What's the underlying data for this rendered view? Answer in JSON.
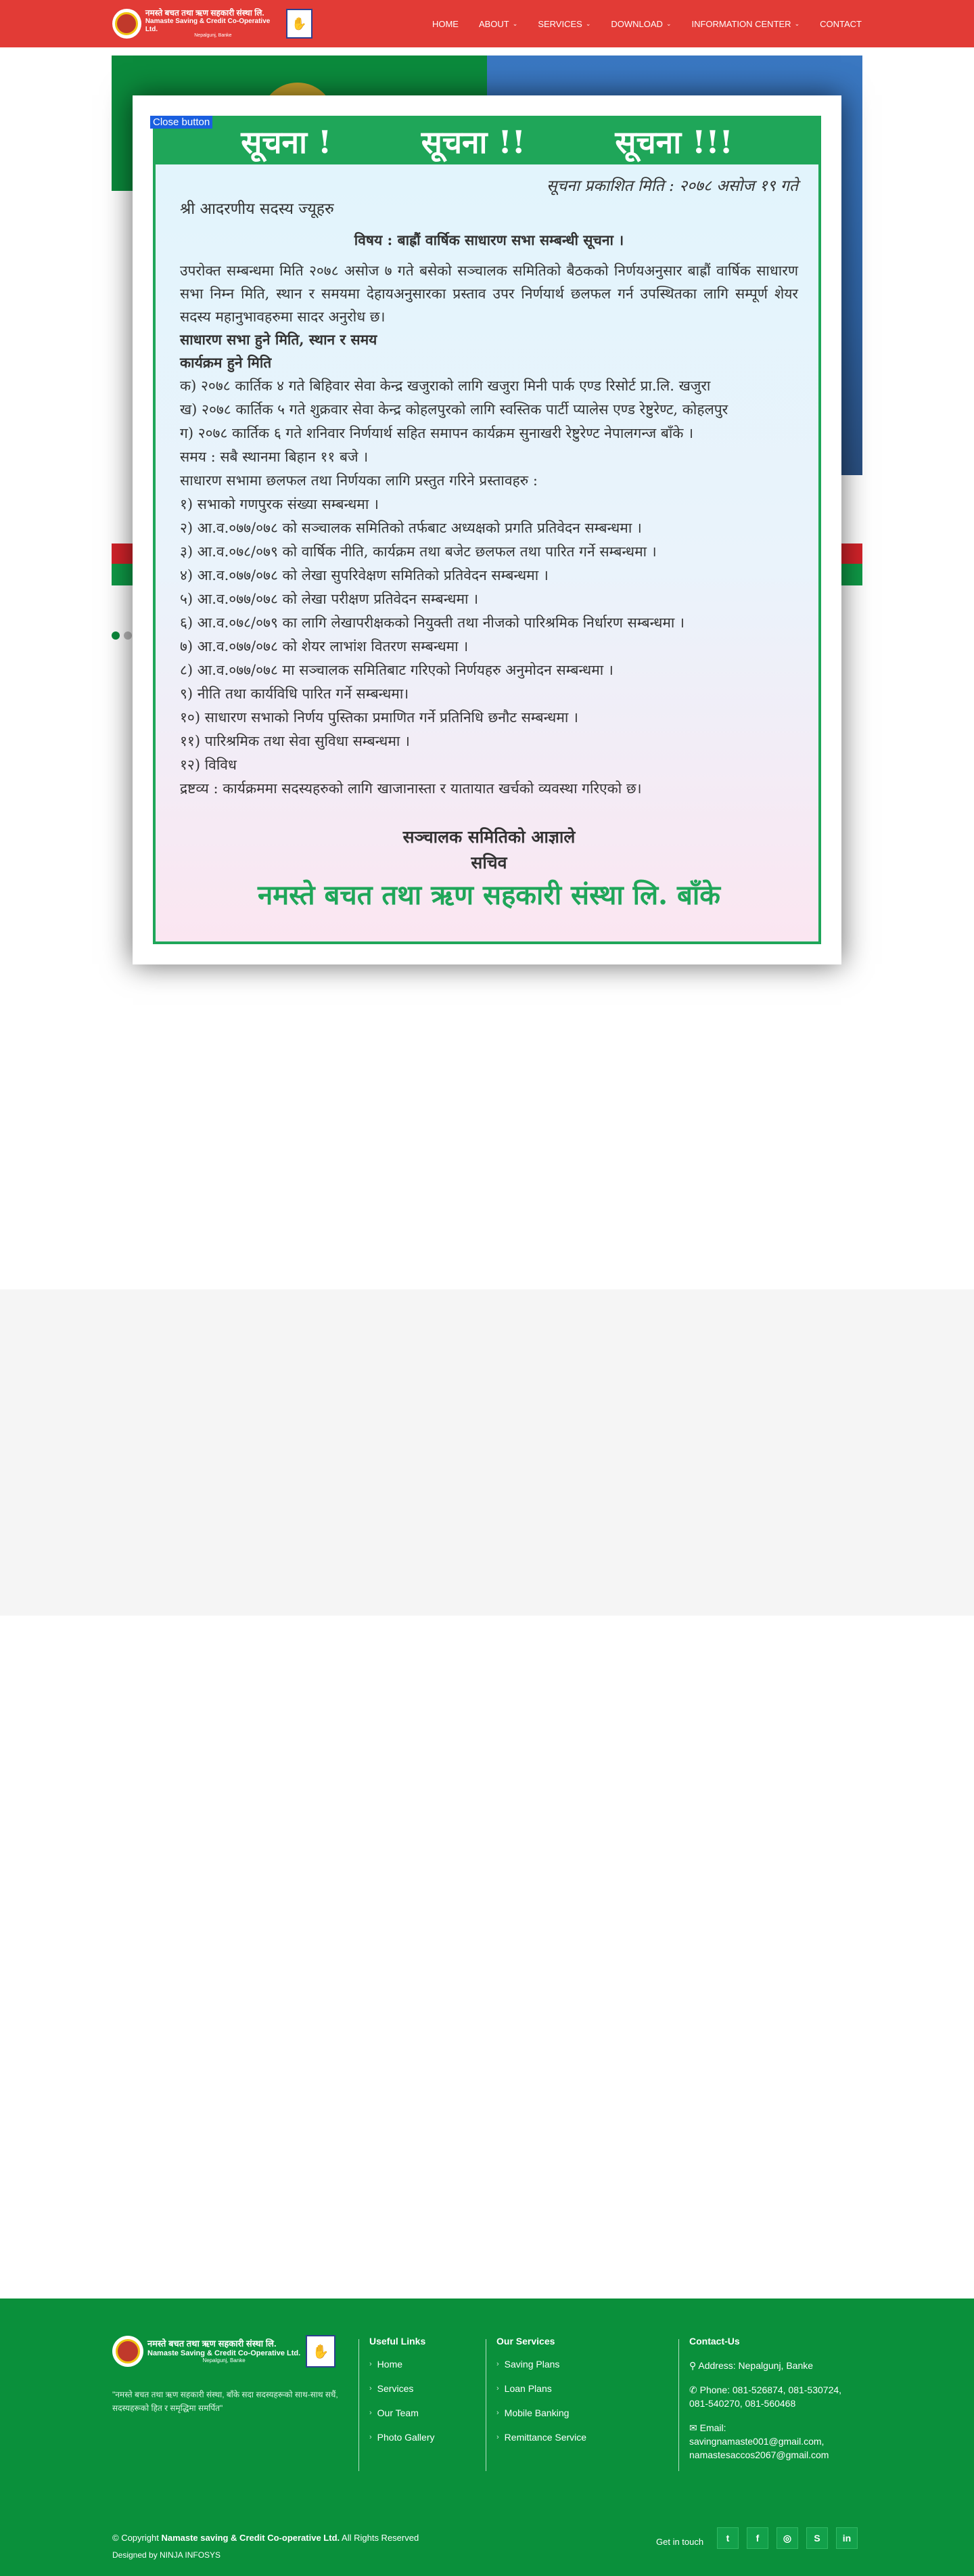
{
  "header": {
    "logo": {
      "line1": "नमस्ते बचत तथा ऋण सहकारी संस्था लि.",
      "line2": "Namaste Saving & Credit Co-Operative Ltd.",
      "line3": "Nepalgunj, Banke"
    },
    "nav": [
      {
        "label": "HOME",
        "dropdown": false
      },
      {
        "label": "ABOUT",
        "dropdown": true
      },
      {
        "label": "SERVICES",
        "dropdown": true
      },
      {
        "label": "DOWNLOAD",
        "dropdown": true
      },
      {
        "label": "INFORMATION CENTER",
        "dropdown": true
      },
      {
        "label": "CONTACT",
        "dropdown": false
      }
    ],
    "chevron": "⌄"
  },
  "modal": {
    "close_label": "Close button",
    "notice_heads": [
      "सूचना !",
      "सूचना !!",
      "सूचना !!!"
    ],
    "pub_date": "सूचना प्रकाशित मिति : २०७८ असोज १९ गते",
    "salutation": "श्री आदरणीय सदस्य ज्यूहरु",
    "subject": "विषय : बाह्रौं वार्षिक साधारण सभा सम्बन्धी सूचना ।",
    "intro": "उपरोक्त सम्बन्धमा मिति २०७८ असोज ७ गते बसेको सञ्चालक समितिको बैठकको निर्णयअनुसार बाह्रौं वार्षिक साधारण सभा निम्न मिति, स्थान र समयमा देहायअनुसारका प्रस्ताव उपर निर्णयार्थ छलफल गर्न उपस्थितका लागि सम्पूर्ण शेयर सदस्य महानुभावहरुमा सादर अनुरोध छ।",
    "h1": "साधारण सभा हुने मिति, स्थान र समय",
    "h2": "कार्यक्रम हुने मिति",
    "lines": [
      "क) २०७८ कार्तिक ४ गते बिहिवार सेवा केन्द्र खजुराको लागि खजुरा मिनी पार्क एण्ड रिसोर्ट प्रा.लि. खजुरा",
      "ख) २०७८ कार्तिक ५ गते शुक्रवार सेवा केन्द्र कोहलपुरको लागि स्वस्तिक पार्टी प्यालेस एण्ड रेष्टुरेण्ट, कोहलपुर",
      "ग) २०७८ कार्तिक ६ गते शनिवार निर्णयार्थ सहित समापन कार्यक्रम सुनाखरी रेष्टुरेण्ट नेपालगन्ज बाँके ।",
      "समय : सबै स्थानमा बिहान ११ बजे ।",
      "साधारण सभामा छलफल तथा निर्णयका लागि प्रस्तुत गरिने प्रस्तावहरु :",
      "१) सभाको गणपुरक संख्या सम्बन्धमा ।",
      "२) आ.व.०७७/०७८ को सञ्चालक समितिको तर्फबाट अध्यक्षको प्रगति प्रतिवेदन सम्बन्धमा ।",
      "३) आ.व.०७८/०७९ को वार्षिक नीति, कार्यक्रम तथा बजेट छलफल तथा पारित गर्ने सम्बन्धमा ।",
      "४) आ.व.०७७/०७८ को लेखा सुपरिवेक्षण समितिको प्रतिवेदन सम्बन्धमा ।",
      "५) आ.व.०७७/०७८ को लेखा परीक्षण प्रतिवेदन सम्बन्धमा ।",
      "६) आ.व.०७८/०७९ का लागि लेखापरीक्षकको नियुक्ती तथा नीजको पारिश्रमिक निर्धारण सम्बन्धमा ।",
      "७) आ.व.०७७/०७८ को शेयर लाभांश वितरण सम्बन्धमा ।",
      "८) आ.व.०७७/०७८ मा सञ्चालक समितिबाट गरिएको निर्णयहरु अनुमोदन सम्बन्धमा ।",
      "९) नीति तथा कार्यविधि पारित गर्ने सम्बन्धमा।",
      "१०) साधारण सभाको निर्णय पुस्तिका प्रमाणित गर्ने प्रतिनिधि छनौट सम्बन्धमा ।",
      "११) पारिश्रमिक तथा सेवा सुविधा सम्बन्धमा ।",
      "१२) विविध",
      "द्रष्टव्य : कार्यक्रममा सदस्यहरुको लागि खाजानास्ता र यातायात खर्चको व्यवस्था गरिएको छ।"
    ],
    "sign1": "सञ्चालक समितिको आज्ञाले",
    "sign2": "सचिव",
    "sign3": "नमस्ते बचत तथा ऋण सहकारी संस्था लि. बाँके"
  },
  "footer": {
    "logo": {
      "line1": "नमस्ते बचत तथा ऋण सहकारी संस्था लि.",
      "line2": "Namaste Saving & Credit Co-Operative Ltd.",
      "line3": "Nepalgunj, Banke"
    },
    "quote": "\"नमस्ते बचत तथा ऋण सहकारी संस्था, बाँके सदा सदस्यहरूको साथ-साथ सधैं, सदस्यहरूको हित र समृद्धिमा समर्पित\"",
    "useful_links_title": "Useful Links",
    "useful_links": [
      "Home",
      "Services",
      "Our Team",
      "Photo Gallery"
    ],
    "services_title": "Our Services",
    "services": [
      "Saving Plans",
      "Loan Plans",
      "Mobile Banking",
      "Remittance Service"
    ],
    "contact_title": "Contact-Us",
    "address": "Address: Nepalgunj, Banke",
    "phone": "Phone: 081-526874, 081-530724, 081-540270, 081-560468",
    "email_label": "Email:",
    "email": "savingnamaste001@gmail.com, namastesaccos2067@gmail.com",
    "copyright_prefix": "© Copyright",
    "copyright_name": "Namaste saving & Credit Co-operative Ltd.",
    "copyright_suffix": "All Rights Reserved",
    "designed_by": "Designed by NINJA INFOSYS",
    "get_in_touch": "Get in touch",
    "socials": [
      {
        "name": "twitter-icon",
        "glyph": "t"
      },
      {
        "name": "facebook-icon",
        "glyph": "f"
      },
      {
        "name": "instagram-icon",
        "glyph": "◎"
      },
      {
        "name": "skype-icon",
        "glyph": "S"
      },
      {
        "name": "linkedin-icon",
        "glyph": "in"
      }
    ],
    "arrow": "›"
  },
  "colors": {
    "header_red": "#e23b36",
    "footer_green": "#0a903b",
    "notice_green": "#1fa659",
    "close_blue": "#1a5fe0"
  }
}
